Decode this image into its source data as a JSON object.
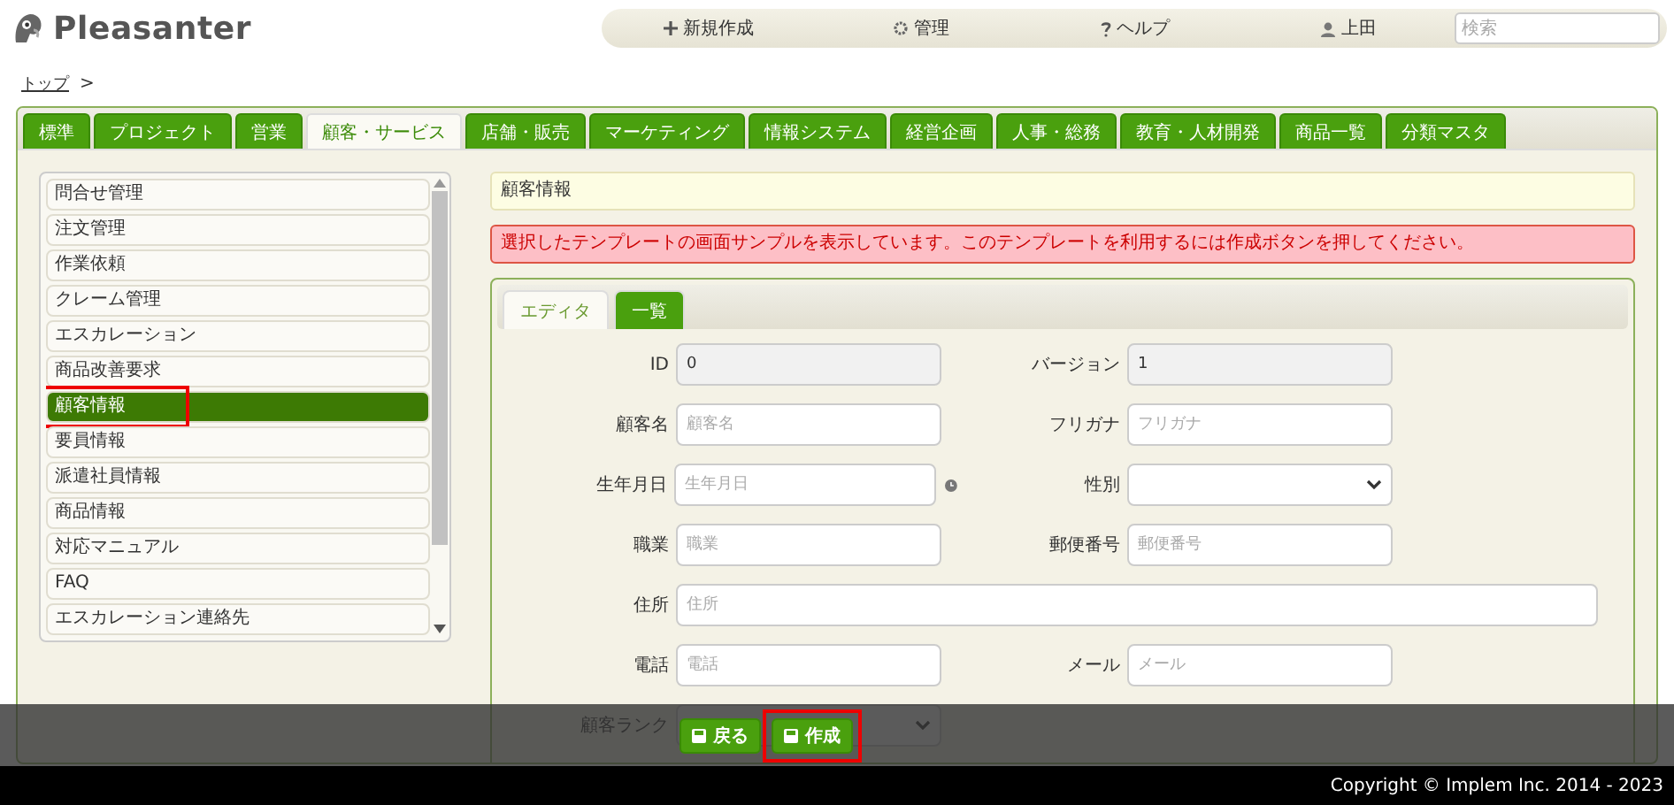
{
  "header": {
    "logo": "Pleasanter",
    "nav": [
      {
        "kind": "new",
        "label": "新規作成"
      },
      {
        "kind": "admin",
        "label": "管理"
      },
      {
        "kind": "help",
        "label": "ヘルプ"
      },
      {
        "kind": "user",
        "label": "上田"
      }
    ],
    "search": {
      "placeholder": "検索"
    }
  },
  "breadcrumb": {
    "link": "トップ",
    "separator": ">"
  },
  "tabs": [
    {
      "label": "標準",
      "selected": false
    },
    {
      "label": "プロジェクト",
      "selected": false
    },
    {
      "label": "営業",
      "selected": false
    },
    {
      "label": "顧客・サービス",
      "selected": true
    },
    {
      "label": "店舗・販売",
      "selected": false
    },
    {
      "label": "マーケティング",
      "selected": false
    },
    {
      "label": "情報システム",
      "selected": false
    },
    {
      "label": "経営企画",
      "selected": false
    },
    {
      "label": "人事・総務",
      "selected": false
    },
    {
      "label": "教育・人材開発",
      "selected": false
    },
    {
      "label": "商品一覧",
      "selected": false
    },
    {
      "label": "分類マスタ",
      "selected": false
    }
  ],
  "sidebar": {
    "items": [
      {
        "label": "問合せ管理",
        "selected": false,
        "highlighted": false
      },
      {
        "label": "注文管理",
        "selected": false,
        "highlighted": false
      },
      {
        "label": "作業依頼",
        "selected": false,
        "highlighted": false
      },
      {
        "label": "クレーム管理",
        "selected": false,
        "highlighted": false
      },
      {
        "label": "エスカレーション",
        "selected": false,
        "highlighted": false
      },
      {
        "label": "商品改善要求",
        "selected": false,
        "highlighted": false
      },
      {
        "label": "顧客情報",
        "selected": true,
        "highlighted": true
      },
      {
        "label": "要員情報",
        "selected": false,
        "highlighted": false
      },
      {
        "label": "派遣社員情報",
        "selected": false,
        "highlighted": false
      },
      {
        "label": "商品情報",
        "selected": false,
        "highlighted": false
      },
      {
        "label": "対応マニュアル",
        "selected": false,
        "highlighted": false
      },
      {
        "label": "FAQ",
        "selected": false,
        "highlighted": false
      },
      {
        "label": "エスカレーション連絡先",
        "selected": false,
        "highlighted": false
      }
    ]
  },
  "title": "顧客情報",
  "message": "選択したテンプレートの画面サンプルを表示しています。このテンプレートを利用するには作成ボタンを押してください。",
  "editor_tabs": [
    {
      "label": "エディタ",
      "selected": true
    },
    {
      "label": "一覧",
      "selected": false
    }
  ],
  "form": {
    "rows": [
      {
        "fields": [
          {
            "kind": "readonly",
            "label": "ID",
            "value": "0"
          },
          {
            "kind": "readonly",
            "label": "バージョン",
            "value": "1"
          }
        ]
      },
      {
        "fields": [
          {
            "kind": "text",
            "label": "顧客名",
            "placeholder": "顧客名"
          },
          {
            "kind": "text",
            "label": "フリガナ",
            "placeholder": "フリガナ"
          }
        ]
      },
      {
        "fields": [
          {
            "kind": "date",
            "label": "生年月日",
            "placeholder": "生年月日"
          },
          {
            "kind": "select",
            "label": "性別"
          }
        ]
      },
      {
        "fields": [
          {
            "kind": "text",
            "label": "職業",
            "placeholder": "職業"
          },
          {
            "kind": "text",
            "label": "郵便番号",
            "placeholder": "郵便番号"
          }
        ]
      },
      {
        "fields": [
          {
            "kind": "wide",
            "label": "住所",
            "placeholder": "住所"
          }
        ]
      },
      {
        "fields": [
          {
            "kind": "text",
            "label": "電話",
            "placeholder": "電話"
          },
          {
            "kind": "text",
            "label": "メール",
            "placeholder": "メール"
          }
        ]
      },
      {
        "fields": [
          {
            "kind": "select",
            "label": "顧客ランク"
          }
        ]
      }
    ]
  },
  "actions": [
    {
      "label": "戻る",
      "highlighted": false
    },
    {
      "label": "作成",
      "highlighted": true
    }
  ],
  "footer": "Copyright © Implem Inc. 2014 - 2023"
}
